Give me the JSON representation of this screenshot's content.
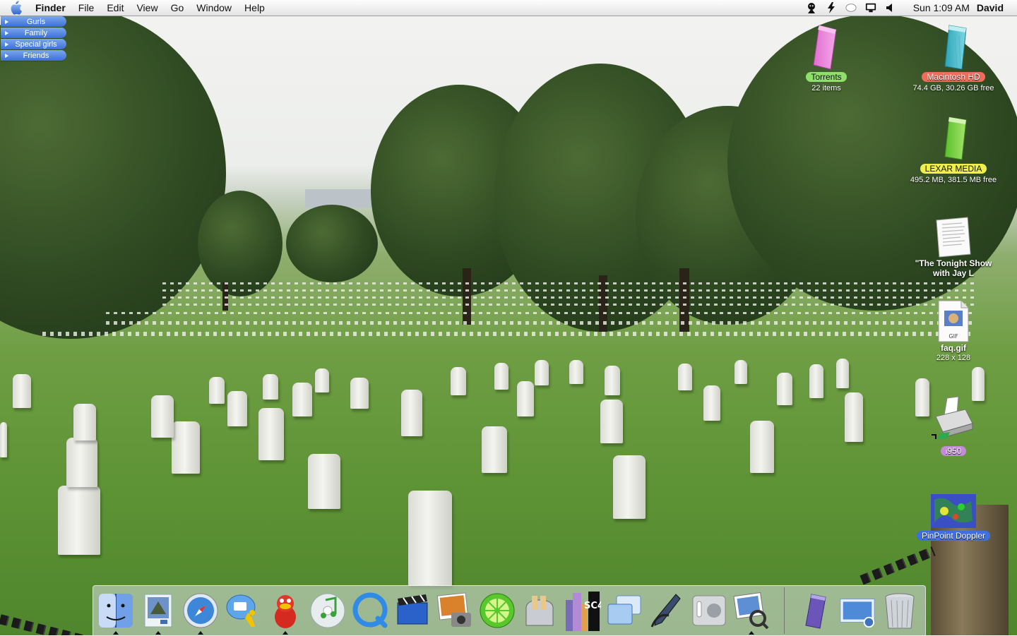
{
  "menubar": {
    "app_name": "Finder",
    "menus": [
      "File",
      "Edit",
      "View",
      "Go",
      "Window",
      "Help"
    ],
    "clock": "Sun 1:09 AM",
    "user": "David"
  },
  "status_icons": [
    "ichat-status-icon",
    "airport-power-icon",
    "bluetooth-icon",
    "display-icon",
    "volume-icon"
  ],
  "tabs": [
    {
      "label": "Gurls"
    },
    {
      "label": "Family"
    },
    {
      "label": "Special girls"
    },
    {
      "label": "Friends"
    }
  ],
  "desktop_icons": {
    "torrents": {
      "label": "Torrents",
      "info": "22 items",
      "color": "#8fe06a"
    },
    "macintosh_hd": {
      "label": "Macintosh HD",
      "info": "74.4 GB, 30.26 GB free",
      "color": "#f26b5b"
    },
    "lexar": {
      "label": "LEXAR MEDIA",
      "info": "495.2 MB, 381.5 MB free",
      "color": "#f0f04a"
    },
    "tonight_show": {
      "label": "\"The Tonight Show with Jay L"
    },
    "faq": {
      "label": "faq.gif",
      "info": "228 x 128",
      "badge": "GIF"
    },
    "printer": {
      "label": "i950",
      "color": "#c58ad8"
    },
    "pinpoint": {
      "label": "PinPoint Doppler",
      "color": "#3f6fe0"
    }
  },
  "dock": {
    "items": [
      {
        "icon": "finder-icon",
        "running": true
      },
      {
        "icon": "mail-icon",
        "running": true
      },
      {
        "icon": "safari-icon",
        "running": true
      },
      {
        "icon": "ichat-icon",
        "running": false
      },
      {
        "icon": "adium-duck-icon",
        "running": true
      },
      {
        "icon": "itunes-icon",
        "running": false
      },
      {
        "icon": "quicktime-icon",
        "running": false
      },
      {
        "icon": "imovie-icon",
        "running": false
      },
      {
        "icon": "iphoto-icon",
        "running": false
      },
      {
        "icon": "limewire-icon",
        "running": false
      },
      {
        "icon": "toast-icon",
        "running": false
      },
      {
        "icon": "simcity4-icon",
        "running": false,
        "text": "SC4"
      },
      {
        "icon": "virtual-pc-icon",
        "running": false
      },
      {
        "icon": "script-editor-icon",
        "running": false
      },
      {
        "icon": "system-preferences-icon",
        "running": false
      },
      {
        "icon": "preview-icon",
        "running": true
      },
      {
        "icon": "drive-icon",
        "running": false
      },
      {
        "icon": "desktop-folder-icon",
        "running": false
      },
      {
        "icon": "trash-icon",
        "running": false
      }
    ]
  }
}
